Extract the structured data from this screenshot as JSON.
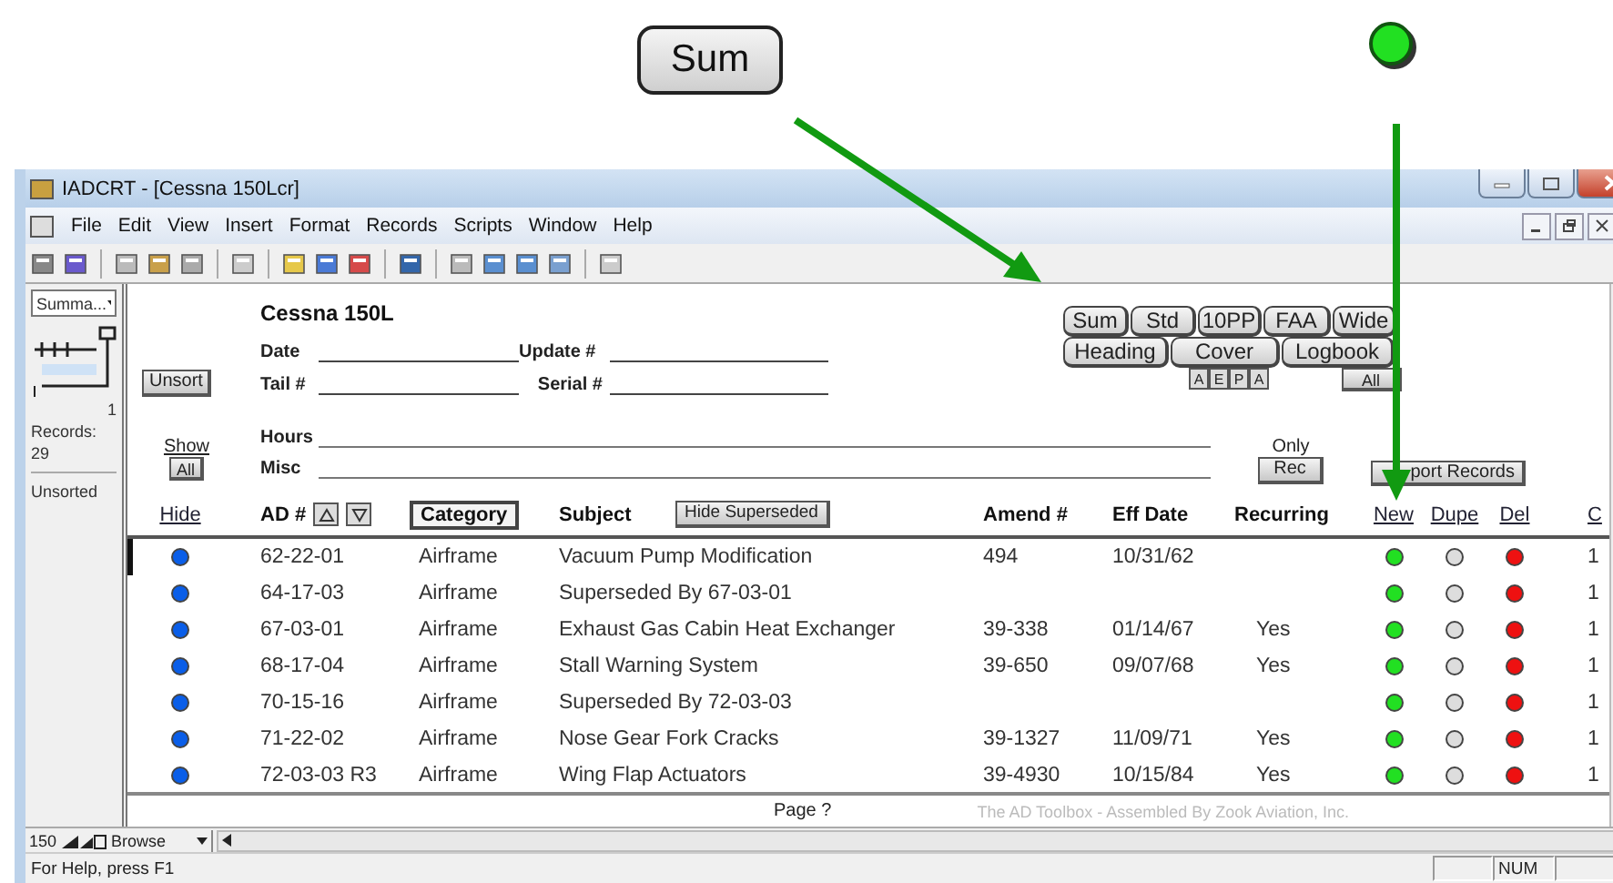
{
  "callout": {
    "label": "Sum"
  },
  "window": {
    "title": "IADCRT - [Cessna 150Lcr]"
  },
  "menu": [
    "File",
    "Edit",
    "View",
    "Insert",
    "Format",
    "Records",
    "Scripts",
    "Window",
    "Help"
  ],
  "sidebar": {
    "layout": "Summa...",
    "count": "1",
    "records_label": "Records:",
    "records": "29",
    "sort_status": "Unsorted"
  },
  "form": {
    "title": "Cessna 150L",
    "unsort": "Unsort",
    "show_label": "Show",
    "show_button": "All",
    "fields": [
      {
        "label": "Date",
        "kind": "half"
      },
      {
        "label": "Update #",
        "kind": "half"
      },
      {
        "label": "Tail #",
        "kind": "half"
      },
      {
        "label": "Serial #",
        "kind": "half"
      },
      {
        "label": "Hours",
        "kind": "full"
      },
      {
        "label": "Misc",
        "kind": "full"
      }
    ],
    "view_buttons": [
      "Sum",
      "Std",
      "10PP",
      "FAA",
      "Wide"
    ],
    "report_buttons": [
      "Heading",
      "Cover",
      "Logbook"
    ],
    "letter_buttons": [
      "A",
      "E",
      "P",
      "A"
    ],
    "all_button": "All",
    "only_label": "Only",
    "rec_button": "Rec",
    "import_button": "port Records"
  },
  "table": {
    "columns": [
      {
        "label": "Hide",
        "kind": "link"
      },
      {
        "label": "AD #",
        "kind": "sort"
      },
      {
        "label": "Category",
        "kind": "boxed"
      },
      {
        "label": "Subject",
        "kind": "plain",
        "button": "Hide Superseded"
      },
      {
        "label": "Amend #",
        "kind": "plain"
      },
      {
        "label": "Eff Date",
        "kind": "plain"
      },
      {
        "label": "Recurring",
        "kind": "plain"
      },
      {
        "label": "New",
        "kind": "link"
      },
      {
        "label": "Dupe",
        "kind": "link"
      },
      {
        "label": "Del",
        "kind": "link"
      },
      {
        "label": "C",
        "kind": "link"
      }
    ],
    "rows": [
      {
        "current": true,
        "ad": "62-22-01",
        "category": "Airframe",
        "subject": "Vacuum Pump Modification",
        "amend": "494",
        "eff_date": "10/31/62",
        "recurring": "",
        "column_11": "1"
      },
      {
        "current": false,
        "ad": "64-17-03",
        "category": "Airframe",
        "subject": "Superseded By 67-03-01",
        "amend": "",
        "eff_date": "",
        "recurring": "",
        "column_11": "1"
      },
      {
        "current": false,
        "ad": "67-03-01",
        "category": "Airframe",
        "subject": "Exhaust Gas Cabin Heat Exchanger",
        "amend": "39-338",
        "eff_date": "01/14/67",
        "recurring": "Yes",
        "column_11": "1"
      },
      {
        "current": false,
        "ad": "68-17-04",
        "category": "Airframe",
        "subject": "Stall Warning System",
        "amend": "39-650",
        "eff_date": "09/07/68",
        "recurring": "Yes",
        "column_11": "1"
      },
      {
        "current": false,
        "ad": "70-15-16",
        "category": "Airframe",
        "subject": "Superseded By 72-03-03",
        "amend": "",
        "eff_date": "",
        "recurring": "",
        "column_11": "1"
      },
      {
        "current": false,
        "ad": "71-22-02",
        "category": "Airframe",
        "subject": "Nose Gear Fork Cracks",
        "amend": "39-1327",
        "eff_date": "11/09/71",
        "recurring": "Yes",
        "column_11": "1"
      },
      {
        "current": false,
        "ad": "72-03-03 R3",
        "category": "Airframe",
        "subject": "Wing Flap Actuators",
        "amend": "39-4930",
        "eff_date": "10/15/84",
        "recurring": "Yes",
        "column_11": "1"
      }
    ]
  },
  "footer": {
    "page": "Page ?",
    "credit": "The AD Toolbox - Assembled By Zook Aviation, Inc."
  },
  "scroll_bar": {
    "zoom": "150",
    "mode": "Browse"
  },
  "status_bar": {
    "help": "For Help, press F1",
    "num": "NUM"
  }
}
